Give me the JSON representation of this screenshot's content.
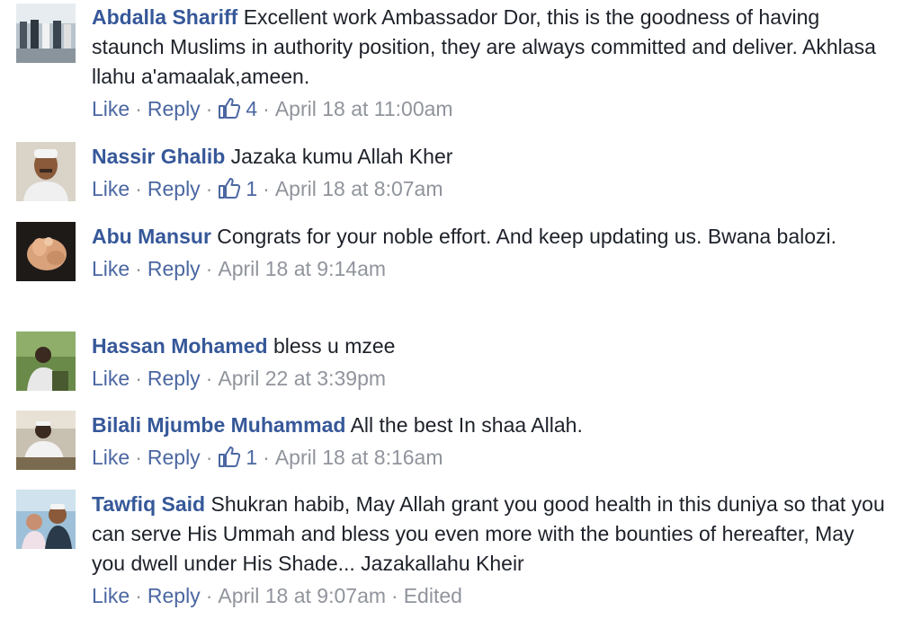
{
  "ui": {
    "like_label": "Like",
    "reply_label": "Reply",
    "separator": "·",
    "like_color": "#4b67a1",
    "author_color": "#365899",
    "meta_color": "#90949c"
  },
  "comments": [
    {
      "author": "Abdalla Shariff",
      "text": "Excellent work Ambassador Dor, this is the goodness of having staunch Muslims in authority position, they are always committed and deliver. Akhlasa llahu a'amaalak,ameen.",
      "likes": "4",
      "time": "April 18 at 11:00am",
      "avatar_icon": "photo-avatar"
    },
    {
      "author": "Nassir Ghalib",
      "text": "Jazaka kumu Allah Kher",
      "likes": "1",
      "time": "April 18 at 8:07am",
      "avatar_icon": "photo-avatar"
    },
    {
      "author": "Abu Mansur",
      "text": "Congrats for your noble effort. And keep updating us. Bwana balozi.",
      "time": "April 18 at 9:14am",
      "avatar_icon": "photo-avatar"
    },
    {
      "author": "Hassan Mohamed",
      "text": "bless u mzee",
      "time": "April 22 at 3:39pm",
      "avatar_icon": "photo-avatar"
    },
    {
      "author": "Bilali Mjumbe Muhammad",
      "text": "All the best In shaa Allah.",
      "likes": "1",
      "time": "April 18 at 8:16am",
      "avatar_icon": "photo-avatar"
    },
    {
      "author": "Tawfiq Said",
      "text": "Shukran habib, May Allah grant you good health in this duniya so that you can serve His Ummah and bless you even more with the bounties of hereafter, May you dwell under His Shade... Jazakallahu Kheir",
      "time": "April 18 at 9:07am",
      "edited": "Edited",
      "avatar_icon": "photo-avatar"
    }
  ]
}
